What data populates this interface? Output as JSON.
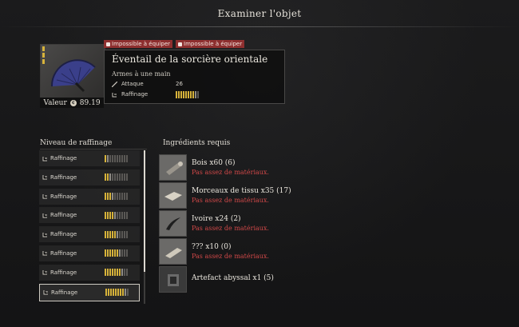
{
  "page": {
    "title": "Examiner l'objet"
  },
  "item": {
    "name": "Éventail de la sorcière orientale",
    "type": "Armes à une main",
    "value_label": "Valeur",
    "value": "89.19",
    "badges": [
      "Impossible à équiper",
      "Impossible à équiper"
    ],
    "stats": [
      {
        "label": "Attaque",
        "value": "26",
        "icon": "sword-icon"
      },
      {
        "label": "Raffinage",
        "value_filled": 8,
        "value_total": 10,
        "icon": "anvil-icon"
      }
    ]
  },
  "refine_list": {
    "title": "Niveau de raffinage",
    "rows": [
      {
        "label": "Raffinage",
        "filled": 1,
        "total": 10
      },
      {
        "label": "Raffinage",
        "filled": 2,
        "total": 10
      },
      {
        "label": "Raffinage",
        "filled": 3,
        "total": 10
      },
      {
        "label": "Raffinage",
        "filled": 4,
        "total": 10
      },
      {
        "label": "Raffinage",
        "filled": 5,
        "total": 10
      },
      {
        "label": "Raffinage",
        "filled": 6,
        "total": 10
      },
      {
        "label": "Raffinage",
        "filled": 7,
        "total": 10
      },
      {
        "label": "Raffinage",
        "filled": 8,
        "total": 10
      }
    ],
    "selected_index": 7
  },
  "ingredients": {
    "title": "Ingrédients requis",
    "items": [
      {
        "name": "Bois x60 (6)",
        "warning": "Pas assez de matériaux.",
        "icon": "wood-log-icon"
      },
      {
        "name": "Morceaux de tissu x35 (17)",
        "warning": "Pas assez de matériaux.",
        "icon": "cloth-icon"
      },
      {
        "name": "Ivoire x24 (2)",
        "warning": "Pas assez de matériaux.",
        "icon": "ivory-horn-icon"
      },
      {
        "name": "??? x10 (0)",
        "warning": "Pas assez de matériaux.",
        "icon": "unknown-material-icon"
      },
      {
        "name": "Artefact abyssal x1 (5)",
        "warning": "",
        "icon": "abyssal-artifact-icon"
      }
    ]
  },
  "colors": {
    "accent_gold": "#d6b23a",
    "warning_red": "#d04848",
    "badge_red": "#8e2f2f"
  }
}
